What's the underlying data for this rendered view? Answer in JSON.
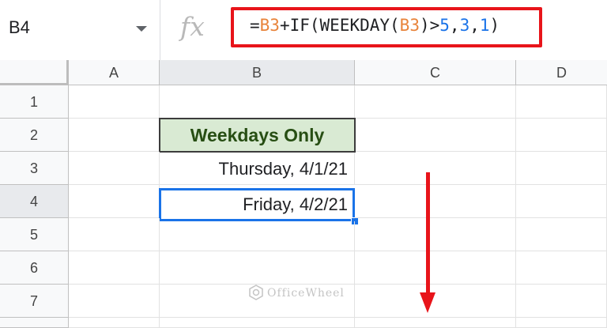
{
  "formula_bar": {
    "cell_reference": "B4",
    "fx_label": "fx",
    "formula": {
      "p1": "=",
      "r1": "B3",
      "p2": "+IF(WEEKDAY(",
      "r2": "B3",
      "p3": ")>",
      "n1": "5",
      "p4": ",",
      "n2": "3",
      "p5": ",",
      "n3": "1",
      "p6": ")"
    }
  },
  "columns": [
    "A",
    "B",
    "C",
    "D"
  ],
  "rows": [
    "1",
    "2",
    "3",
    "4",
    "5",
    "6",
    "7"
  ],
  "cells": {
    "B2": "Weekdays Only",
    "B3": "Thursday, 4/1/21",
    "B4": "Friday, 4/2/21"
  },
  "selected_cell": "B4",
  "watermark": "OfficeWheel",
  "colors": {
    "highlight_box": "#e8141a",
    "arrow": "#e8141a",
    "selection": "#1a73e8",
    "header_fill": "#d9ead3",
    "header_text": "#274e13",
    "formula_ref": "#e8833a",
    "formula_number": "#1a73e8"
  }
}
